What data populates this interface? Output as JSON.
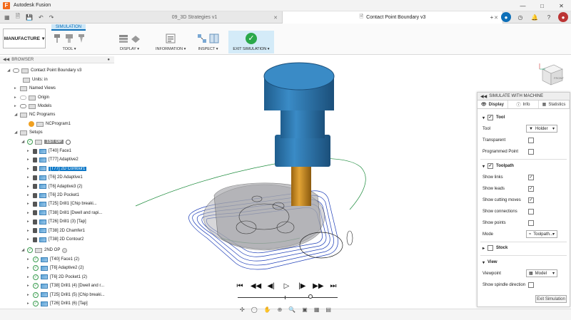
{
  "app": {
    "title": "Autodesk Fusion"
  },
  "tabs": [
    {
      "label": "09_3D Strategies v1"
    },
    {
      "label": "Contact Point Boundary v3"
    }
  ],
  "ribbon": {
    "workspace": "MANUFACTURE",
    "active_tab": "SIMULATION",
    "groups": [
      "TOOL",
      "DISPLAY",
      "INFORMATION",
      "INSPECT",
      "EXIT SIMULATION"
    ]
  },
  "browser": {
    "header": "BROWSER",
    "root": "Contact Point Boundary v3",
    "units": "Units: in",
    "named_views": "Named Views",
    "origin": "Origin",
    "models": "Models",
    "nc_programs": "NC Programs",
    "nc_program1": "NCProgram1",
    "setups": "Setups",
    "op1": "1ST OP",
    "op1_items": [
      "[T40] Face1",
      "[T77] Adaptive2",
      "[T77] 2D Contour1",
      "[T6] 2D Adaptive1",
      "[T6] Adaptive3 (2)",
      "[T6] 2D Pocket1",
      "[T25] Drill1 [Chip breaki...",
      "[T38] Drill1 [Dwell and rapi...",
      "[T26] Drill1 (3) [Tap]",
      "[T38] 2D Chamfer1",
      "[T38] 2D Contour2"
    ],
    "op2": "2ND OP",
    "op2_items": [
      "[T40] Face1 (2)",
      "[T6] Adaptive2 (2)",
      "[T6] 2D Pocket1 (2)",
      "[T38] Drill1 (4) [Dwell and r...",
      "[T25] Drill1 (5) [Chip breaki...",
      "[T26] Drill1 (6) [Tap]"
    ]
  },
  "panel": {
    "title": "SIMULATE WITH MACHINE",
    "tabs": [
      "Display",
      "Info",
      "Statistics"
    ],
    "tool_section": "Tool",
    "tool_label": "Tool",
    "tool_value": "Holder",
    "transparent": "Transparent",
    "programmed_point": "Programmed Point",
    "toolpath_section": "Toolpath",
    "show_links": "Show links",
    "show_leads": "Show leads",
    "show_cutting_moves": "Show cutting moves",
    "show_connections": "Show connections",
    "show_points": "Show points",
    "mode_label": "Mode",
    "mode_value": "Toolpath...",
    "stock_section": "Stock",
    "view_section": "View",
    "viewpoint_label": "Viewpoint",
    "viewpoint_value": "Model",
    "show_spindle": "Show spindle direction",
    "exit_button": "Exit Simulation"
  },
  "viewcube": {
    "label": "FRONT"
  },
  "colors": {
    "accent": "#0e79c8",
    "tool_blue": "#2a6e9f",
    "holder_gold": "#c98a1c",
    "toolpath": "#1f3fb8"
  }
}
